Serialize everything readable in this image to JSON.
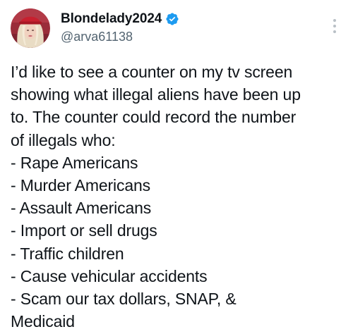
{
  "author": {
    "display_name": "Blondelady2024",
    "handle": "@arva61138",
    "avatar_icon": "profile-photo",
    "verified_icon": "verified-badge-icon"
  },
  "menu_icon": "more-options-icon",
  "colors": {
    "text": "#0f1419",
    "secondary": "#536471",
    "verified": "#1d9bf0",
    "background": "#ffffff"
  },
  "tweet": {
    "lines": [
      "I’d like to see a counter on my tv screen",
      "showing what illegal aliens have been up",
      "to. The counter could record the number",
      "of illegals who:",
      "- Rape Americans",
      "- Murder Americans",
      "- Assault Americans",
      "- Import or sell drugs",
      "- Traffic children",
      "- Cause vehicular accidents",
      "- Scam our tax dollars, SNAP, &",
      "Medicaid"
    ]
  }
}
